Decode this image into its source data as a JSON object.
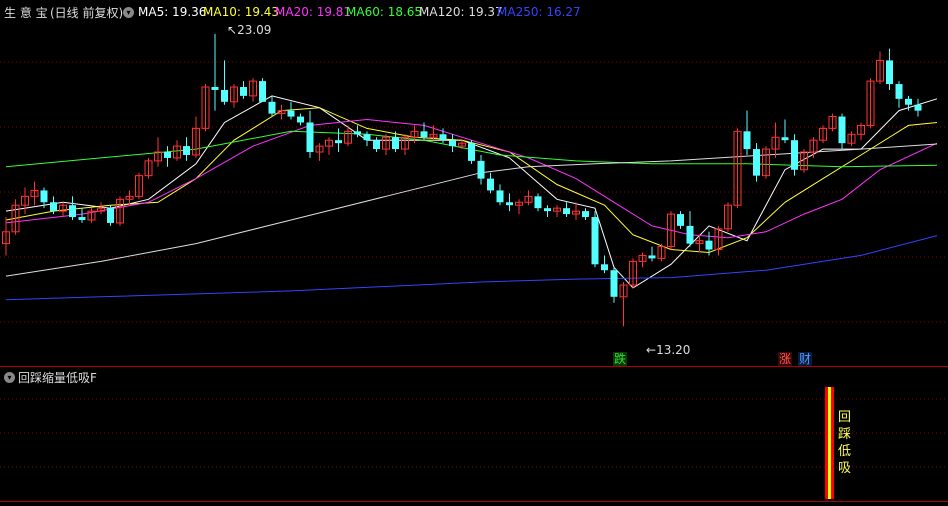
{
  "header": {
    "stock_name": "生 意 宝",
    "period": "(日线 前复权)",
    "legend": [
      {
        "label": "MA5: 19.36",
        "color": "#ffffff"
      },
      {
        "label": "MA10: 19.43",
        "color": "#ffff33"
      },
      {
        "label": "MA20: 19.81",
        "color": "#ff33ff"
      },
      {
        "label": "MA60: 18.65",
        "color": "#33ff33"
      },
      {
        "label": "MA120: 19.37",
        "color": "#dddddd"
      },
      {
        "label": "MA250: 16.27",
        "color": "#3344ff"
      }
    ]
  },
  "annotations": {
    "high_price": "23.09",
    "low_price": "13.20",
    "tag_die": "跌",
    "tag_zhang": "涨",
    "tag_cai": "财"
  },
  "indicator_panel": {
    "title": "回踩缩量低吸F",
    "signal_text": "回踩低吸"
  },
  "colors": {
    "up": "#ff3333",
    "down": "#54ffff",
    "grid": "#8b0000",
    "signal_yellow": "#ffff00",
    "signal_red": "#ff0000"
  },
  "chart_data": {
    "type": "candlestick",
    "ylim": [
      12.4,
      23.5
    ],
    "candles": [
      [
        16.0,
        16.9,
        15.6,
        16.4
      ],
      [
        16.4,
        17.5,
        16.3,
        17.3
      ],
      [
        17.3,
        17.9,
        17.0,
        17.6
      ],
      [
        17.6,
        18.1,
        17.3,
        17.8
      ],
      [
        17.8,
        17.9,
        17.2,
        17.4
      ],
      [
        17.4,
        17.6,
        17.0,
        17.1
      ],
      [
        17.1,
        17.4,
        16.9,
        17.3
      ],
      [
        17.3,
        17.6,
        16.8,
        16.9
      ],
      [
        16.9,
        17.2,
        16.7,
        16.8
      ],
      [
        16.8,
        17.2,
        16.7,
        17.1
      ],
      [
        17.1,
        17.4,
        17.0,
        17.2
      ],
      [
        17.2,
        17.3,
        16.6,
        16.7
      ],
      [
        16.7,
        17.6,
        16.6,
        17.5
      ],
      [
        17.5,
        17.8,
        17.3,
        17.6
      ],
      [
        17.6,
        18.4,
        17.5,
        18.3
      ],
      [
        18.3,
        18.9,
        18.2,
        18.8
      ],
      [
        18.8,
        19.6,
        18.6,
        19.1
      ],
      [
        19.1,
        19.3,
        18.6,
        18.9
      ],
      [
        18.9,
        19.5,
        18.8,
        19.3
      ],
      [
        19.3,
        19.6,
        18.8,
        19.0
      ],
      [
        19.0,
        20.3,
        18.9,
        19.9
      ],
      [
        19.9,
        21.4,
        19.8,
        21.3
      ],
      [
        21.3,
        23.1,
        20.5,
        21.2
      ],
      [
        21.2,
        22.2,
        20.7,
        20.8
      ],
      [
        20.8,
        21.4,
        20.6,
        21.3
      ],
      [
        21.3,
        21.5,
        20.9,
        21.0
      ],
      [
        21.0,
        21.6,
        20.8,
        21.5
      ],
      [
        21.5,
        21.6,
        20.8,
        20.8
      ],
      [
        20.8,
        21.0,
        20.3,
        20.4
      ],
      [
        20.4,
        20.7,
        20.2,
        20.5
      ],
      [
        20.5,
        20.8,
        20.2,
        20.3
      ],
      [
        20.3,
        20.4,
        20.0,
        20.1
      ],
      [
        20.1,
        20.5,
        18.9,
        19.1
      ],
      [
        19.1,
        19.4,
        18.8,
        19.3
      ],
      [
        19.3,
        19.6,
        19.0,
        19.5
      ],
      [
        19.5,
        19.9,
        19.1,
        19.4
      ],
      [
        19.4,
        20.0,
        19.3,
        19.8
      ],
      [
        19.8,
        20.0,
        19.6,
        19.7
      ],
      [
        19.7,
        19.8,
        19.3,
        19.5
      ],
      [
        19.5,
        19.6,
        19.1,
        19.2
      ],
      [
        19.2,
        19.7,
        19.0,
        19.6
      ],
      [
        19.6,
        19.8,
        19.1,
        19.2
      ],
      [
        19.2,
        19.7,
        19.0,
        19.6
      ],
      [
        19.6,
        20.0,
        19.4,
        19.8
      ],
      [
        19.8,
        20.1,
        19.5,
        19.6
      ],
      [
        19.6,
        20.0,
        19.5,
        19.7
      ],
      [
        19.7,
        19.9,
        19.4,
        19.5
      ],
      [
        19.5,
        19.7,
        19.1,
        19.3
      ],
      [
        19.3,
        19.5,
        19.2,
        19.4
      ],
      [
        19.4,
        19.5,
        18.7,
        18.8
      ],
      [
        18.8,
        19.0,
        18.0,
        18.2
      ],
      [
        18.2,
        18.4,
        17.7,
        17.8
      ],
      [
        17.8,
        18.0,
        17.3,
        17.4
      ],
      [
        17.4,
        17.7,
        17.1,
        17.3
      ],
      [
        17.3,
        17.5,
        17.0,
        17.4
      ],
      [
        17.4,
        17.8,
        17.3,
        17.6
      ],
      [
        17.6,
        17.7,
        17.1,
        17.2
      ],
      [
        17.2,
        17.3,
        16.9,
        17.1
      ],
      [
        17.1,
        17.3,
        16.9,
        17.2
      ],
      [
        17.2,
        17.4,
        16.9,
        17.0
      ],
      [
        17.0,
        17.4,
        16.8,
        17.1
      ],
      [
        17.1,
        17.2,
        16.8,
        16.9
      ],
      [
        16.9,
        17.1,
        15.2,
        15.3
      ],
      [
        15.3,
        15.6,
        15.0,
        15.1
      ],
      [
        15.1,
        15.2,
        14.0,
        14.2
      ],
      [
        14.2,
        14.7,
        13.2,
        14.6
      ],
      [
        14.6,
        15.5,
        14.5,
        15.4
      ],
      [
        15.4,
        15.7,
        15.2,
        15.6
      ],
      [
        15.6,
        15.9,
        15.4,
        15.5
      ],
      [
        15.5,
        16.0,
        15.4,
        15.9
      ],
      [
        15.9,
        17.1,
        15.8,
        17.0
      ],
      [
        17.0,
        17.1,
        16.5,
        16.6
      ],
      [
        16.6,
        17.1,
        15.9,
        16.0
      ],
      [
        16.0,
        16.3,
        15.7,
        16.1
      ],
      [
        16.1,
        16.4,
        15.6,
        15.8
      ],
      [
        15.8,
        16.6,
        15.6,
        16.5
      ],
      [
        16.5,
        17.4,
        16.4,
        17.3
      ],
      [
        17.3,
        19.9,
        17.2,
        19.8
      ],
      [
        19.8,
        20.5,
        19.0,
        19.2
      ],
      [
        19.2,
        19.4,
        18.1,
        18.3
      ],
      [
        18.3,
        19.3,
        18.2,
        19.2
      ],
      [
        19.2,
        20.1,
        18.9,
        19.6
      ],
      [
        19.6,
        20.2,
        19.4,
        19.5
      ],
      [
        19.5,
        19.7,
        18.3,
        18.5
      ],
      [
        18.5,
        19.2,
        18.4,
        19.1
      ],
      [
        19.1,
        19.6,
        18.9,
        19.5
      ],
      [
        19.5,
        20.0,
        19.4,
        19.9
      ],
      [
        19.9,
        20.4,
        19.8,
        20.3
      ],
      [
        20.3,
        20.4,
        19.2,
        19.4
      ],
      [
        19.4,
        19.8,
        19.3,
        19.7
      ],
      [
        19.7,
        20.1,
        19.5,
        20.0
      ],
      [
        20.0,
        21.6,
        19.9,
        21.5
      ],
      [
        21.5,
        22.5,
        21.4,
        22.2
      ],
      [
        22.2,
        22.6,
        21.2,
        21.4
      ],
      [
        21.4,
        21.5,
        20.6,
        20.9
      ],
      [
        20.9,
        21.0,
        20.5,
        20.7
      ],
      [
        20.7,
        20.9,
        20.3,
        20.5
      ]
    ],
    "ma_series": [
      {
        "name": "MA5",
        "color": "#ffffff",
        "values": [
          [
            0,
            17.1
          ],
          [
            6,
            17.4
          ],
          [
            11,
            17.2
          ],
          [
            15,
            17.5
          ],
          [
            20,
            18.7
          ],
          [
            23,
            20.1
          ],
          [
            28,
            21.0
          ],
          [
            33,
            20.6
          ],
          [
            38,
            19.5
          ],
          [
            43,
            19.5
          ],
          [
            48,
            19.5
          ],
          [
            53,
            18.9
          ],
          [
            58,
            17.5
          ],
          [
            62,
            17.2
          ],
          [
            64,
            15.2
          ],
          [
            66,
            14.5
          ],
          [
            70,
            15.3
          ],
          [
            74,
            16.6
          ],
          [
            78,
            16.1
          ],
          [
            82,
            18.5
          ],
          [
            86,
            19.2
          ],
          [
            90,
            19.2
          ],
          [
            94,
            20.5
          ],
          [
            98,
            20.9
          ]
        ]
      },
      {
        "name": "MA10",
        "color": "#ffff33",
        "values": [
          [
            0,
            16.8
          ],
          [
            5,
            17.1
          ],
          [
            11,
            17.3
          ],
          [
            16,
            17.4
          ],
          [
            20,
            18.2
          ],
          [
            24,
            19.5
          ],
          [
            29,
            20.5
          ],
          [
            33,
            20.6
          ],
          [
            38,
            19.9
          ],
          [
            43,
            19.6
          ],
          [
            48,
            19.5
          ],
          [
            53,
            19.1
          ],
          [
            58,
            18.0
          ],
          [
            63,
            17.3
          ],
          [
            66,
            16.3
          ],
          [
            70,
            15.8
          ],
          [
            74,
            15.7
          ],
          [
            78,
            16.2
          ],
          [
            82,
            17.4
          ],
          [
            86,
            18.2
          ],
          [
            90,
            19.0
          ],
          [
            95,
            20.0
          ],
          [
            98,
            20.1
          ]
        ]
      },
      {
        "name": "MA20",
        "color": "#ff33ff",
        "values": [
          [
            0,
            16.7
          ],
          [
            8,
            17.0
          ],
          [
            15,
            17.4
          ],
          [
            20,
            18.2
          ],
          [
            26,
            19.3
          ],
          [
            32,
            20.0
          ],
          [
            38,
            20.2
          ],
          [
            44,
            20.0
          ],
          [
            50,
            19.4
          ],
          [
            55,
            18.9
          ],
          [
            60,
            18.2
          ],
          [
            64,
            17.4
          ],
          [
            68,
            16.6
          ],
          [
            72,
            16.3
          ],
          [
            76,
            16.2
          ],
          [
            80,
            16.4
          ],
          [
            84,
            17.0
          ],
          [
            88,
            17.5
          ],
          [
            92,
            18.5
          ],
          [
            98,
            19.4
          ]
        ]
      },
      {
        "name": "MA60",
        "color": "#33ff33",
        "values": [
          [
            0,
            18.6
          ],
          [
            10,
            18.9
          ],
          [
            20,
            19.2
          ],
          [
            30,
            19.8
          ],
          [
            38,
            19.7
          ],
          [
            44,
            19.5
          ],
          [
            52,
            19.0
          ],
          [
            60,
            18.8
          ],
          [
            68,
            18.7
          ],
          [
            78,
            18.7
          ],
          [
            88,
            18.6
          ],
          [
            98,
            18.65
          ]
        ]
      },
      {
        "name": "MA120",
        "color": "#dddddd",
        "values": [
          [
            0,
            14.9
          ],
          [
            10,
            15.4
          ],
          [
            20,
            16.0
          ],
          [
            30,
            16.8
          ],
          [
            40,
            17.6
          ],
          [
            50,
            18.4
          ],
          [
            55,
            18.6
          ],
          [
            62,
            18.7
          ],
          [
            70,
            18.8
          ],
          [
            80,
            19.0
          ],
          [
            90,
            19.2
          ],
          [
            98,
            19.37
          ]
        ]
      },
      {
        "name": "MA250",
        "color": "#3344ff",
        "values": [
          [
            0,
            14.1
          ],
          [
            10,
            14.2
          ],
          [
            20,
            14.3
          ],
          [
            30,
            14.4
          ],
          [
            40,
            14.55
          ],
          [
            50,
            14.7
          ],
          [
            60,
            14.8
          ],
          [
            70,
            14.85
          ],
          [
            80,
            15.1
          ],
          [
            90,
            15.6
          ],
          [
            98,
            16.27
          ]
        ]
      }
    ],
    "signal": {
      "index": 82,
      "label": "回踩低吸"
    }
  }
}
